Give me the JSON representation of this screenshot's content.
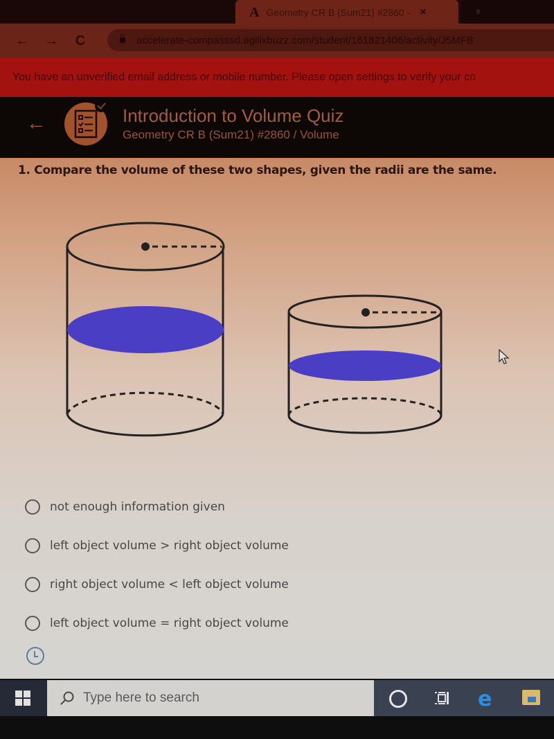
{
  "browser": {
    "active_tab": {
      "favicon": "A",
      "title": "Geometry CR B (Sum21) #2860 -",
      "close_glyph": "×"
    },
    "next_tab_badge": "8",
    "nav": {
      "back": "←",
      "forward": "→",
      "reload": "C"
    },
    "url": "accelerate-compasssd.agilixbuzz.com/student/161821406/activity/J5MFB"
  },
  "banner": {
    "text": "You have an unverified email address or mobile number. Please open settings to verify your co"
  },
  "quiz_header": {
    "back_glyph": "←",
    "icon": "quiz-checklist-icon",
    "title": "Introduction to Volume Quiz",
    "subtitle": "Geometry CR B (Sum21) #2860 / Volume"
  },
  "question": {
    "text": "1. Compare the volume of these two shapes, given the radii are the same.",
    "figure": {
      "shapes": [
        {
          "name": "left cylinder",
          "relative_height": "taller",
          "fill_color": "#4a3ec4"
        },
        {
          "name": "right cylinder",
          "relative_height": "shorter",
          "fill_color": "#4a3ec4"
        }
      ]
    },
    "options": [
      {
        "label": "not enough information given",
        "selected": false
      },
      {
        "label": "left object volume > right object volume",
        "selected": false
      },
      {
        "label": "right object volume < left object volume",
        "selected": false
      },
      {
        "label": "left object volume = right object volume",
        "selected": false
      }
    ]
  },
  "taskbar": {
    "start_icon": "windows-logo-icon",
    "search_placeholder": "Type here to search",
    "edge_glyph": "e",
    "pinned": [
      "cortana-icon",
      "task-view-icon",
      "edge-icon",
      "file-explorer-icon"
    ]
  }
}
